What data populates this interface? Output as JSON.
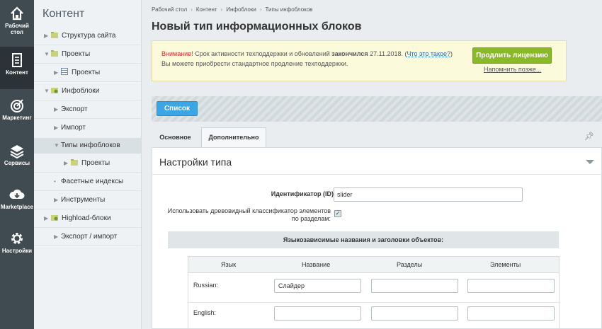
{
  "rail": {
    "items": [
      {
        "label": "Рабочий стол",
        "icon": "home-icon"
      },
      {
        "label": "Контент",
        "icon": "document-icon"
      },
      {
        "label": "Маркетинг",
        "icon": "target-icon"
      },
      {
        "label": "Сервисы",
        "icon": "layers-icon"
      },
      {
        "label": "Marketplace",
        "icon": "cloud-download-icon"
      },
      {
        "label": "Настройки",
        "icon": "gear-icon"
      }
    ]
  },
  "tree": {
    "title": "Контент",
    "items": [
      {
        "label": "Структура сайта"
      },
      {
        "label": "Проекты"
      },
      {
        "label": "Проекты"
      },
      {
        "label": "Инфоблоки"
      },
      {
        "label": "Экспорт"
      },
      {
        "label": "Импорт"
      },
      {
        "label": "Типы инфоблоков"
      },
      {
        "label": "Проекты"
      },
      {
        "label": "Фасетные индексы"
      },
      {
        "label": "Инструменты"
      },
      {
        "label": "Highload-блоки"
      },
      {
        "label": "Экспорт / импорт"
      }
    ]
  },
  "breadcrumbs": [
    "Рабочий стол",
    "Контент",
    "Инфоблоки",
    "Типы инфоблоков"
  ],
  "page": {
    "title": "Новый тип информационных блоков"
  },
  "warning": {
    "attention": "Внимание!",
    "text1": " Срок активности техподдержки и обновлений ",
    "ended": "закончился",
    "date": " 27.11.2018. (",
    "what_link": "Что это такое?",
    "close_paren": ")",
    "text2": "Вы можете приобрести стандартное продление техподдержки.",
    "extend_button": "Продлить лицензию",
    "remind_link": "Напомнить позже..."
  },
  "toolbar": {
    "list_button": "Список"
  },
  "tabs": [
    {
      "label": "Основное"
    },
    {
      "label": "Дополнительно"
    }
  ],
  "panel": {
    "title": "Настройки типа",
    "id_label": "Идентификатор (ID):",
    "id_value": "slider",
    "tree_label": "Использовать древовидный классификатор элементов по разделам:",
    "tree_checked": "✓",
    "section_header": "Языкозависимые названия и заголовки объектов:"
  },
  "lang_table": {
    "headers": [
      "Язык",
      "Название",
      "Разделы",
      "Элементы"
    ],
    "rows": [
      {
        "lang": "Russian:",
        "name": "Слайдер",
        "sections": "",
        "elements": ""
      },
      {
        "lang": "English:",
        "name": "",
        "sections": "",
        "elements": ""
      }
    ]
  },
  "colors": {
    "rail_bg": "#3f4b51",
    "accent_green": "#8ab927",
    "accent_blue": "#3aa6e5",
    "warning_red": "#d8232a"
  }
}
